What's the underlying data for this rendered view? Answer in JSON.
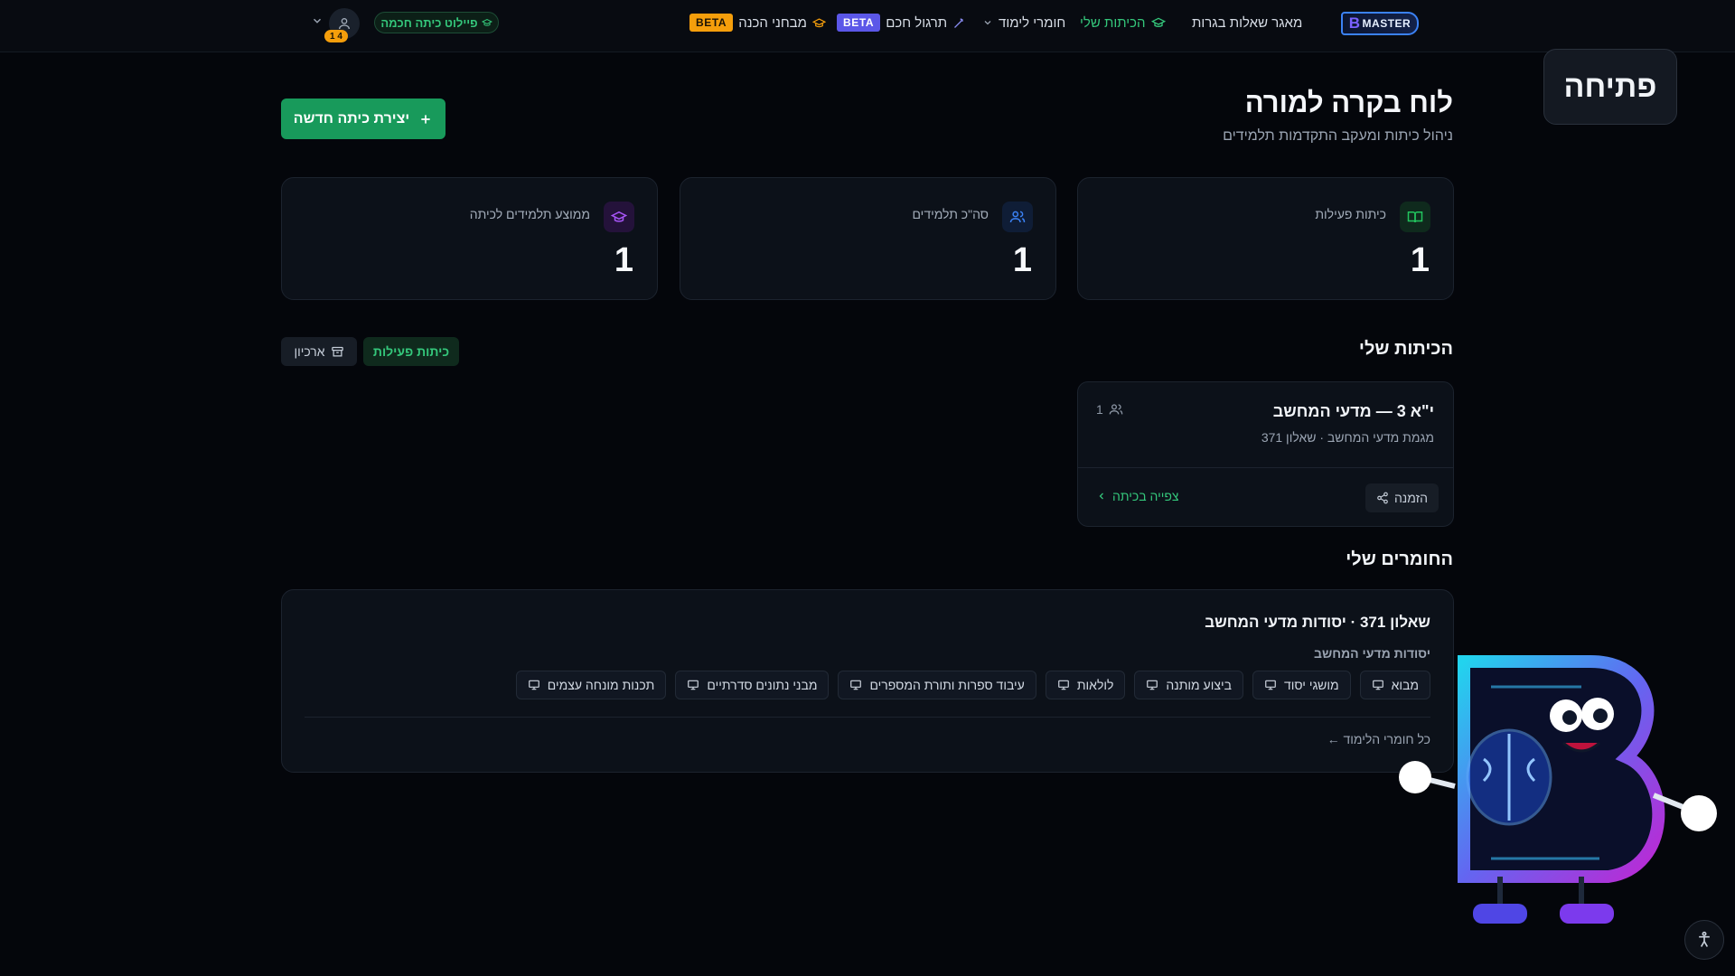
{
  "topbar": {
    "logo_text": "MASTER",
    "logo_letter": "B",
    "nav": {
      "question_bank": "מאגר שאלות בגרות",
      "my_classes": "הכיתות שלי",
      "study_materials": "חומרי לימוד",
      "smart_practice": "תרגול חכם",
      "practice_beta": "BETA",
      "prep_exams": "מבחני הכנה",
      "exams_beta": "BETA"
    },
    "pilot_pill": "פיילוט כיתה חכמה",
    "avatar_badge": "1 4"
  },
  "open_button": "פתיחה",
  "header": {
    "title": "לוח בקרה למורה",
    "subtitle": "ניהול כיתות ומעקב התקדמות תלמידים",
    "new_class_button": "יצירת כיתה חדשה"
  },
  "stats": [
    {
      "label": "כיתות פעילות",
      "value": "1",
      "icon": "book-open-icon",
      "color": "#22c55e"
    },
    {
      "label": "סה\"כ תלמידים",
      "value": "1",
      "icon": "users-icon",
      "color": "#3b82f6"
    },
    {
      "label": "ממוצע תלמידים לכיתה",
      "value": "1",
      "icon": "graduation-cap-icon",
      "color": "#a855f7"
    }
  ],
  "classes": {
    "title": "הכיתות שלי",
    "tab_active": "כיתות פעילות",
    "tab_archive": "ארכיון",
    "card": {
      "name": "י\"א 3 — מדעי המחשב",
      "meta": "מגמת מדעי המחשב · שאלון 371",
      "student_count": "1",
      "invite": "הזמנה",
      "view": "צפייה בכיתה"
    }
  },
  "materials": {
    "title": "החומרים שלי",
    "course_title": "שאלון 371 · יסודות מדעי המחשב",
    "subject": "יסודות מדעי המחשב",
    "chips": [
      "מבוא",
      "מושגי יסוד",
      "ביצוע מותנה",
      "לולאות",
      "עיבוד ספרות ותורת המספרים",
      "מבני נתונים סדרתיים",
      "תכנות מונחה עצמים"
    ],
    "all_link": "← כל חומרי הלימוד"
  },
  "colors": {
    "accent_green": "#189a5b",
    "beta_purple": "#5b57e8",
    "beta_orange": "#f59e0b"
  }
}
